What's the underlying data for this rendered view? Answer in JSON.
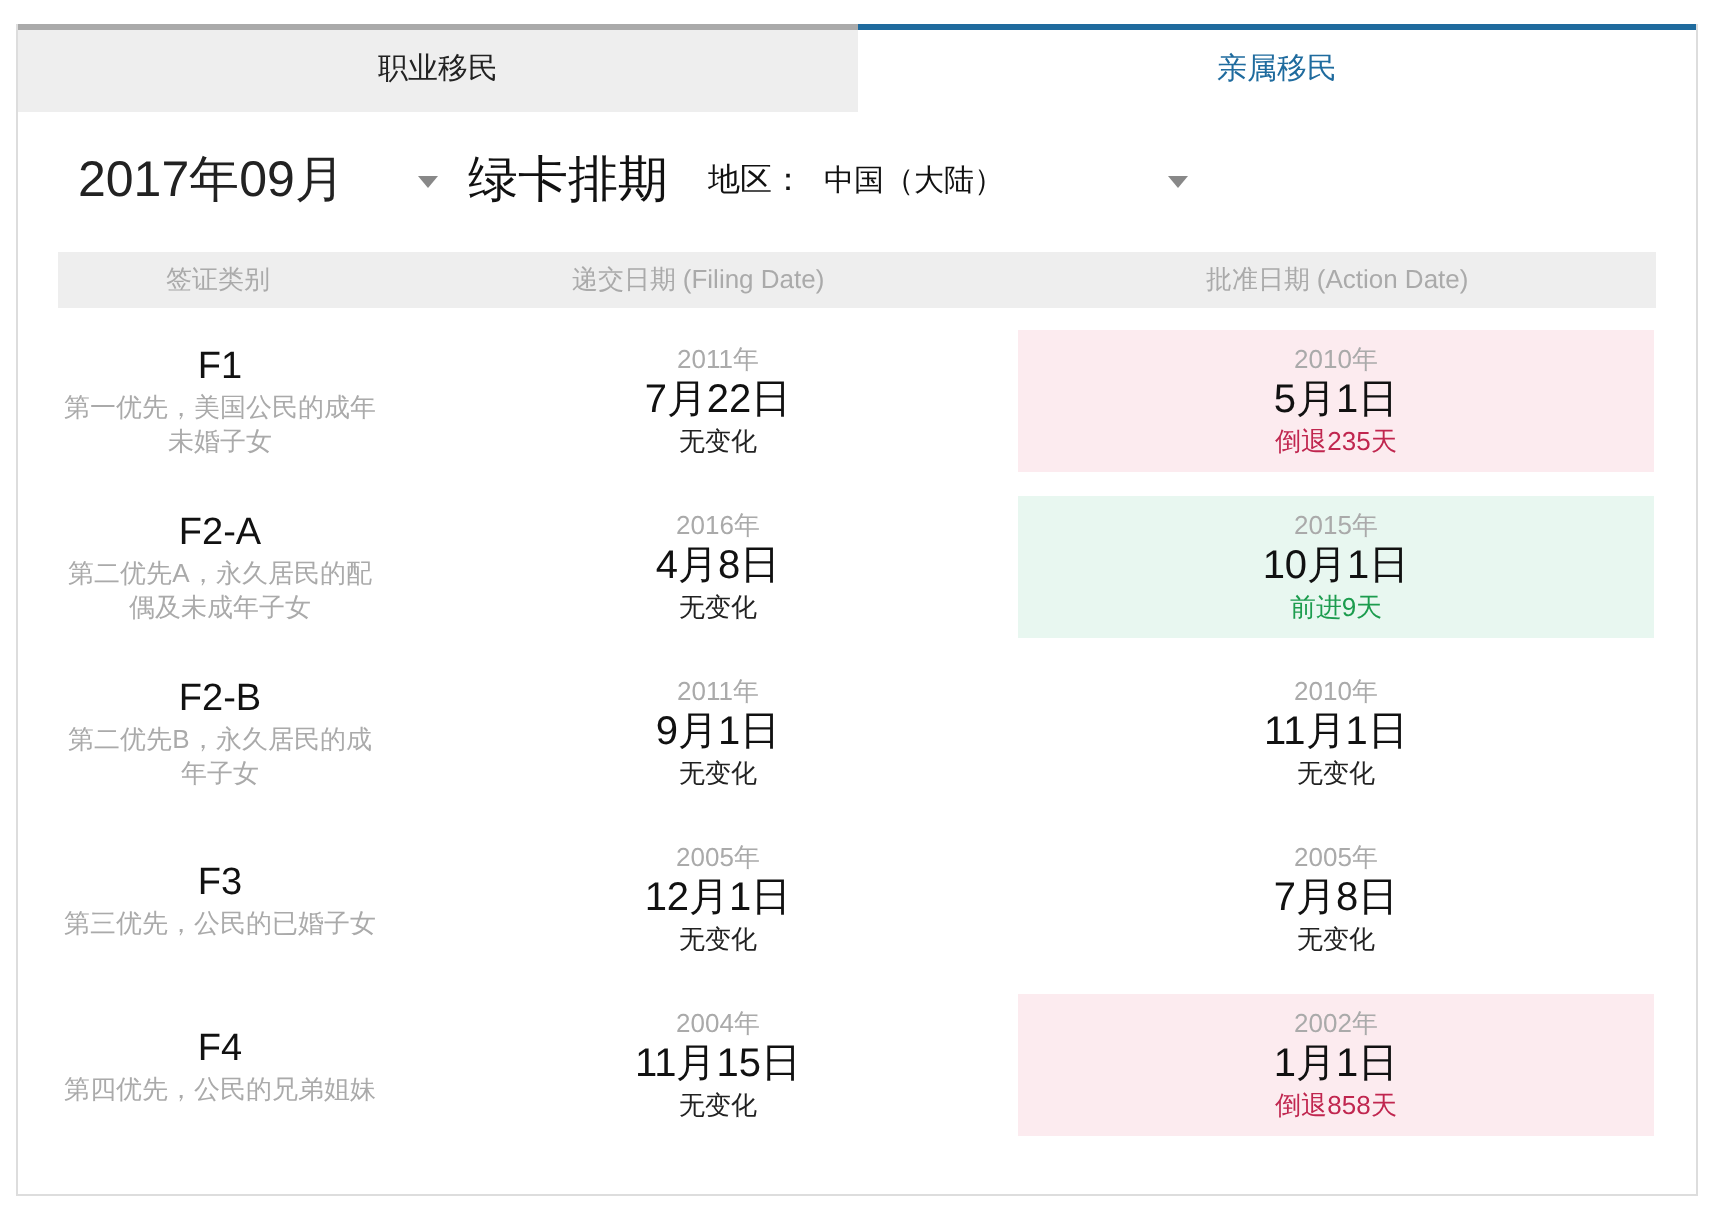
{
  "tabs": [
    {
      "label": "职业移民",
      "selected": false
    },
    {
      "label": "亲属移民",
      "selected": true
    }
  ],
  "header": {
    "month": "2017年09月",
    "title": "绿卡排期",
    "region_label": "地区：",
    "region": "中国（大陆）"
  },
  "columns": [
    "签证类别",
    "递交日期 (Filing Date)",
    "批准日期 (Action Date)"
  ],
  "rows": [
    {
      "code": "F1",
      "description": "第一优先，美国公民的成年未婚子女",
      "filing": {
        "year": "2011年",
        "date": "7月22日",
        "change": "无变化"
      },
      "action": {
        "year": "2010年",
        "date": "5月1日",
        "change": "倒退235天",
        "kind": "back"
      }
    },
    {
      "code": "F2-A",
      "description": "第二优先A，永久居民的配偶及未成年子女",
      "filing": {
        "year": "2016年",
        "date": "4月8日",
        "change": "无变化"
      },
      "action": {
        "year": "2015年",
        "date": "10月1日",
        "change": "前进9天",
        "kind": "forward"
      }
    },
    {
      "code": "F2-B",
      "description": "第二优先B，永久居民的成年子女",
      "filing": {
        "year": "2011年",
        "date": "9月1日",
        "change": "无变化"
      },
      "action": {
        "year": "2010年",
        "date": "11月1日",
        "change": "无变化",
        "kind": "none"
      }
    },
    {
      "code": "F3",
      "description": "第三优先，公民的已婚子女",
      "filing": {
        "year": "2005年",
        "date": "12月1日",
        "change": "无变化"
      },
      "action": {
        "year": "2005年",
        "date": "7月8日",
        "change": "无变化",
        "kind": "none"
      }
    },
    {
      "code": "F4",
      "description": "第四优先，公民的兄弟姐妹",
      "filing": {
        "year": "2004年",
        "date": "11月15日",
        "change": "无变化"
      },
      "action": {
        "year": "2002年",
        "date": "1月1日",
        "change": "倒退858天",
        "kind": "back"
      }
    }
  ]
}
